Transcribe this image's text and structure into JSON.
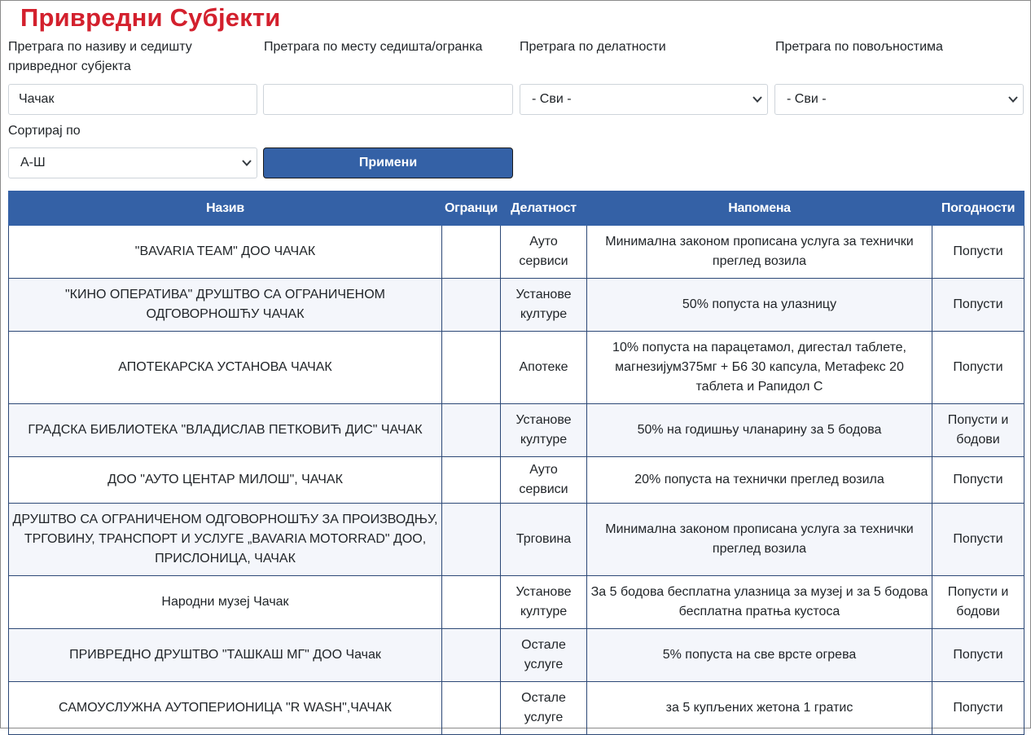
{
  "page": {
    "title": "Привредни Субјекти"
  },
  "filters": {
    "name_label": "Претрага по називу и седишту привредног субјекта",
    "name_value": "Чачак",
    "place_label": "Претрага по месту седишта/огранка",
    "place_value": "",
    "activity_label": "Претрага по делатности",
    "activity_value": "- Сви -",
    "benefit_label": "Претрага по повољностима",
    "benefit_value": "- Сви -",
    "sort_label": "Сортирај по",
    "sort_value": "А-Ш",
    "apply_label": "Примени"
  },
  "table": {
    "headers": [
      "Назив",
      "Огранци",
      "Делатност",
      "Напомена",
      "Погодности"
    ],
    "rows": [
      [
        "\"BAVARIA TEAM\" ДОО ЧАЧАК",
        "",
        "Ауто сервиси",
        "Минимална законом прописана услуга за технички преглед возила",
        "Попусти"
      ],
      [
        "\"КИНО ОПЕРАТИВА\" ДРУШТВО СА ОГРАНИЧЕНОМ ОДГОВОРНОШЋУ ЧАЧАК",
        "",
        "Установе културе",
        "50% попуста на улазницу",
        "Попусти"
      ],
      [
        "АПОТЕКАРСКА УСТАНОВА ЧАЧАК",
        "",
        "Апотеке",
        "10% попуста на парацетамол, дигестал таблете, магнезијум375мг + Б6 30 капсула, Метафекс 20 таблета и Рапидол С",
        "Попусти"
      ],
      [
        "ГРАДСКА БИБЛИОТЕКА \"ВЛАДИСЛАВ ПЕТКОВИЋ ДИС\" ЧАЧАК",
        "",
        "Установе културе",
        "50% на годишњу чланарину за 5 бодова",
        "Попусти и бодови"
      ],
      [
        "ДОО \"АУТО ЦЕНТАР МИЛОШ\", ЧАЧАК",
        "",
        "Ауто сервиси",
        "20% попуста на технички преглед возила",
        "Попусти"
      ],
      [
        "ДРУШТВО СА ОГРАНИЧЕНОМ ОДГОВОРНОШЋУ ЗА ПРОИЗВОДЊУ, ТРГОВИНУ, ТРАНСПОРТ И УСЛУГЕ „BAVARIA MOTORRAD\" ДОО, ПРИСЛОНИЦА, ЧАЧАК",
        "",
        "Трговина",
        "Минимална законом прописана услуга за технички преглед возила",
        "Попусти"
      ],
      [
        "Народни музеј Чачак",
        "",
        "Установе културе",
        "За 5 бодова бесплатна улазница за музеј и за 5 бодова бесплатна пратња кустоса",
        "Попусти и бодови"
      ],
      [
        "ПРИВРЕДНО ДРУШТВО \"ТАШКАШ МГ\" ДОО Чачак",
        "",
        "Остале услуге",
        "5% попуста на све врсте огрева",
        "Попусти"
      ],
      [
        "САМОУСЛУЖНА АУТОПЕРИОНИЦА \"R WASH\",ЧАЧАК",
        "",
        "Остале услуге",
        "за 5 купљених жетона 1 гратис",
        "Попусти"
      ]
    ]
  },
  "colors": {
    "title_red": "#d3202d",
    "header_blue": "#3461a6",
    "border_navy": "#2c4876"
  }
}
